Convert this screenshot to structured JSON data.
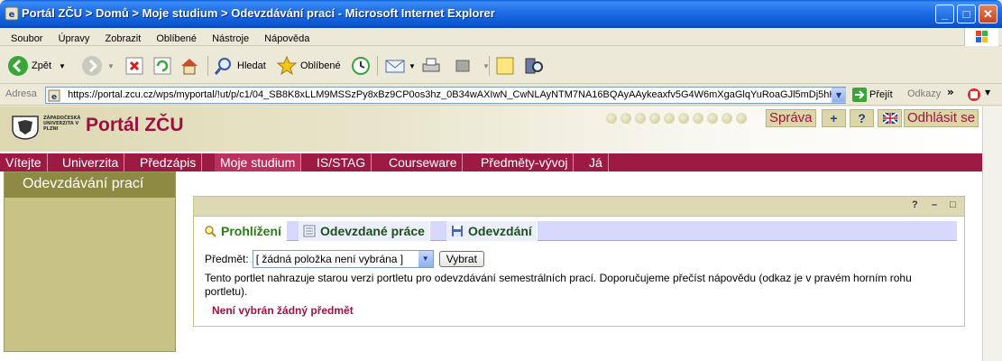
{
  "window": {
    "title": "Portál ZČU > Domů > Moje studium > Odevzdávání prací - Microsoft Internet Explorer",
    "minimize": "_",
    "maximize": "□",
    "close": "✕"
  },
  "menu": [
    "Soubor",
    "Úpravy",
    "Zobrazit",
    "Oblíbené",
    "Nástroje",
    "Nápověda"
  ],
  "toolbar": {
    "back": "Zpět",
    "search": "Hledat",
    "favorites": "Oblíbené"
  },
  "address": {
    "label": "Adresa",
    "url": "https://portal.zcu.cz/wps/myportal/!ut/p/c1/04_SB8K8xLLM9MSSzPy8xBz9CP0os3hz_0B34wAXIwN_CwNLAyNTM7NA16BQAyAAykeaxfv5G4W6mXgaGlqYuRoaGJl5mDj5hHkauLsY",
    "go": "Přejít",
    "links": "Odkazy"
  },
  "portal": {
    "brand": "Portál ZČU",
    "crest_text": "ZÁPADOČESKÁ UNIVERZITA V PLZNI",
    "buttons": {
      "admin": "Správa",
      "add": "+",
      "help": "?",
      "logout": "Odhlásit se"
    },
    "nav": [
      "Vítejte",
      "Univerzita",
      "Předzápis",
      "Moje studium",
      "IS/STAG",
      "Courseware",
      "Předměty-vývoj",
      "Já"
    ],
    "active_nav": "Moje studium",
    "left_title": "Odevzdávání prací"
  },
  "portlet": {
    "controls": [
      "?",
      "–",
      "□"
    ],
    "tabs": [
      "Prohlížení",
      "Odevzdané práce",
      "Odevzdání"
    ],
    "subject_label": "Předmět:",
    "subject_value": "[ žádná položka není vybrána ]",
    "select_button": "Vybrat",
    "description": "Tento portlet nahrazuje starou verzi portletu pro odevzdávání semestrálních prací. Doporučujeme přečíst nápovědu (odkaz je v pravém horním rohu portletu).",
    "warning": "Není vybrán žádný předmět"
  },
  "colors": {
    "brand": "#9c1040",
    "nav": "#9c1a43",
    "panel": "#c7c387"
  }
}
